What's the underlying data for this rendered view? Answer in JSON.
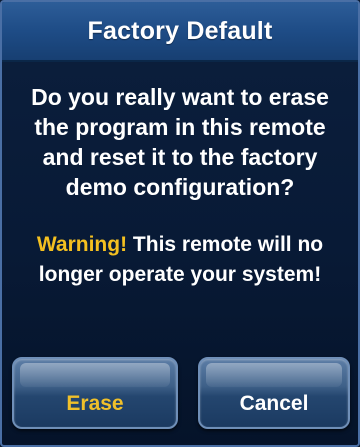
{
  "dialog": {
    "title": "Factory Default",
    "question": "Do you really want to erase the program in this remote and reset it to the factory demo configuration?",
    "warning_label": "Warning!",
    "warning_text": " This remote will no longer operate your system!"
  },
  "buttons": {
    "erase_label": "Erase",
    "cancel_label": "Cancel"
  },
  "colors": {
    "header_blue": "#1e4c86",
    "background_navy": "#081a36",
    "warning_yellow": "#f4c020",
    "text_white": "#ffffff"
  }
}
